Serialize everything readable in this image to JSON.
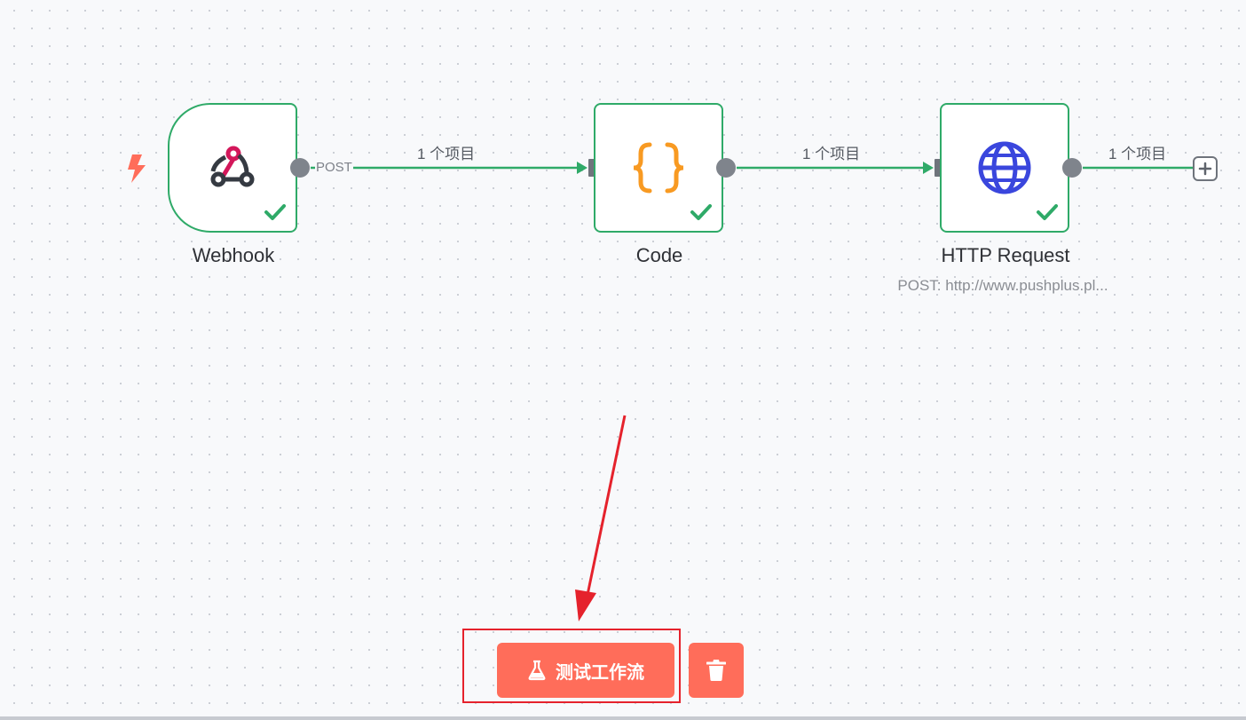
{
  "nodes": [
    {
      "name": "Webhook",
      "icon": "webhook-icon",
      "status": "success"
    },
    {
      "name": "Code",
      "icon": "code-braces-icon",
      "status": "success"
    },
    {
      "name": "HTTP Request",
      "icon": "globe-icon",
      "status": "success",
      "subtitle": "POST: http://www.pushplus.pl..."
    }
  ],
  "edges": [
    {
      "from": "Webhook",
      "to": "Code",
      "output_label": "POST",
      "items_label": "1 个项目"
    },
    {
      "from": "Code",
      "to": "HTTP Request",
      "items_label": "1 个项目"
    },
    {
      "from": "HTTP Request",
      "to": "add",
      "items_label": "1 个项目"
    }
  ],
  "toolbar": {
    "test_workflow_label": "测试工作流",
    "test_workflow_icon": "flask-icon",
    "delete_icon": "trash-icon"
  },
  "annotation": {
    "type": "red-arrow-and-box",
    "color": "#e5222c",
    "target": "test-workflow-button"
  },
  "colors": {
    "success": "#2faa68",
    "accent": "#ff6d5a",
    "trigger": "#ff6d5a",
    "code_icon": "#f89a22",
    "http_icon": "#3a46dd",
    "webhook_icon_red": "#d3175a",
    "webhook_icon_dark": "#353a42"
  }
}
